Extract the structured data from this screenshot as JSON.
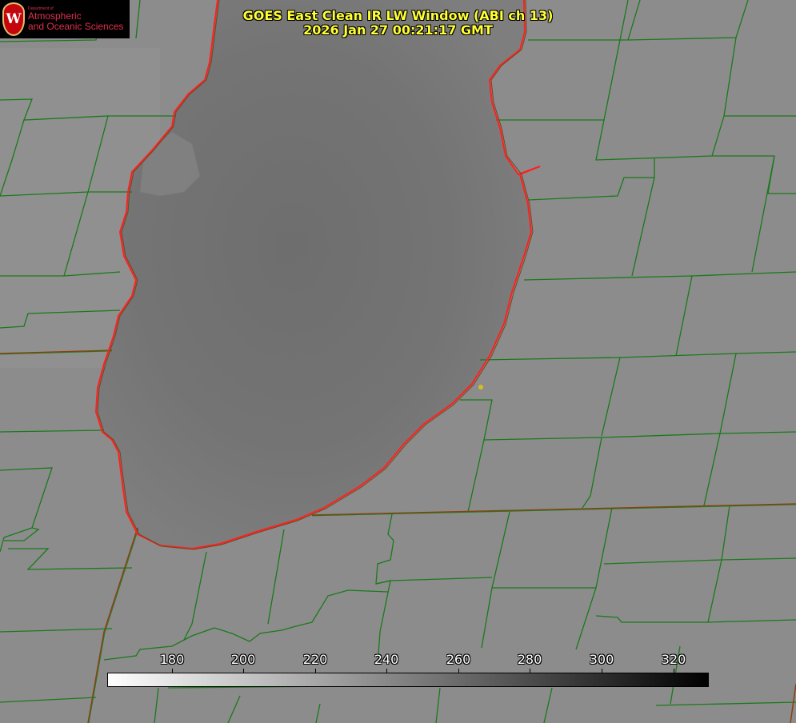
{
  "title": {
    "line1": "GOES East Clean IR LW Window (ABI ch 13)",
    "line2": "2026 Jan 27 00:21:17 GMT"
  },
  "logo": {
    "seal_letter": "W",
    "dept_small": "Department of",
    "line1": "Atmospheric",
    "line2": "and Oceanic Sciences"
  },
  "colorbar": {
    "labels": [
      "180",
      "200",
      "220",
      "240",
      "260",
      "280",
      "300",
      "320"
    ],
    "colors": {
      "start": "#ffffff",
      "end": "#000000"
    }
  },
  "colors": {
    "background": "#8a8a8a",
    "county_lines": "#1a7a1a",
    "state_lines": "#8a4010",
    "coastline": "#ff2020",
    "title": "#ffff33",
    "marker": "#d4c020"
  }
}
